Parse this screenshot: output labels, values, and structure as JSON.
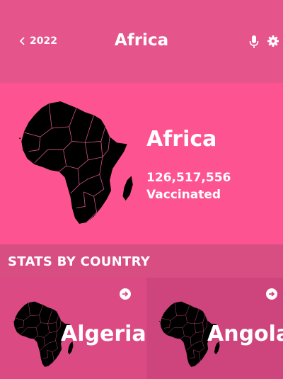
{
  "header": {
    "back_label": "2022",
    "title": "Africa",
    "icons": [
      "chevron-left-icon",
      "microphone-icon",
      "gear-icon"
    ]
  },
  "hero": {
    "region_name": "Africa",
    "vaccinated_count": "126,517,556",
    "vaccinated_label": "Vaccinated"
  },
  "stats": {
    "section_title": "STATS BY COUNTRY",
    "countries": [
      {
        "name": "Algeria"
      },
      {
        "name": "Angola"
      }
    ]
  },
  "colors": {
    "header_bg": "#e5558c",
    "hero_bg": "#fd5390",
    "stats_bg": "#d84d82",
    "card1_bg": "#dc4a84",
    "card2_bg": "#ce447c"
  }
}
